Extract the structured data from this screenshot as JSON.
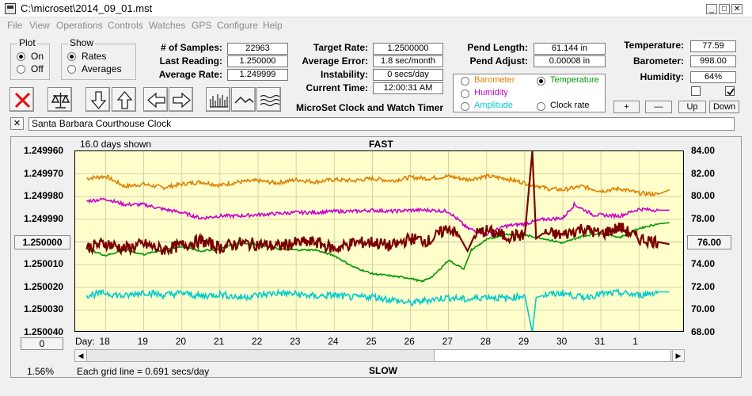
{
  "window": {
    "title": "C:\\microset\\2014_09_01.mst"
  },
  "menu": [
    "File",
    "View",
    "Operations",
    "Controls",
    "Watches",
    "GPS",
    "Configure",
    "Help"
  ],
  "plot_group": {
    "title": "Plot",
    "on_label": "On",
    "off_label": "Off",
    "selected": "On"
  },
  "show_group": {
    "title": "Show",
    "rates_label": "Rates",
    "averages_label": "Averages",
    "selected": "Rates"
  },
  "stats": {
    "samples_label": "# of Samples:",
    "samples": "22963",
    "last_reading_label": "Last Reading:",
    "last_reading": "1.250000",
    "average_rate_label": "Average Rate:",
    "average_rate": "1.249999",
    "target_rate_label": "Target Rate:",
    "target_rate": "1.2500000",
    "average_error_label": "Average Error:",
    "average_error": "1.8 sec/month",
    "instability_label": "Instability:",
    "instability": "0 secs/day",
    "current_time_label": "Current Time:",
    "current_time": "12:00:31 AM",
    "pend_length_label": "Pend Length:",
    "pend_length": "61.144 in",
    "pend_adjust_label": "Pend Adjust:",
    "pend_adjust": "0.00008 in",
    "temperature_label": "Temperature:",
    "temperature": "77.59",
    "barometer_label": "Barometer:",
    "barometer": "998.00",
    "humidity_label": "Humidity:",
    "humidity": "64%"
  },
  "app_caption": "MicroSet Clock and Watch Timer",
  "channel_select": {
    "options": [
      {
        "label": "Barometer",
        "color": "#e08000",
        "selected": false
      },
      {
        "label": "Temperature",
        "color": "#009900",
        "selected": true
      },
      {
        "label": "Humidity",
        "color": "#cc00cc",
        "selected": false
      },
      {
        "label": "Clock rate",
        "color": "#000000",
        "selected": false
      },
      {
        "label": "Amplitude",
        "color": "#00cccc",
        "selected": false
      }
    ]
  },
  "scale_buttons": {
    "plus": "+",
    "minus": "—",
    "up": "Up",
    "down": "Down"
  },
  "toolbar_icons": [
    "close-x-icon",
    "balance-scale-icon",
    "arrow-down-icon",
    "arrow-up-icon",
    "arrow-left-icon",
    "arrow-right-icon",
    "bars-icon",
    "wave-icon",
    "multi-wave-icon"
  ],
  "clock_name": {
    "close": "✕",
    "value": "Santa Barbara Courthouse Clock"
  },
  "chart": {
    "days_shown": "16.0 days shown",
    "top_label": "FAST",
    "bottom_label": "SLOW",
    "center_button": "1.250000",
    "right_button": "76.00",
    "zero_button": "0",
    "grid_note": "Each grid line = 0.691 secs/day",
    "zoom_percent": "1.56%",
    "day_prefix": "Day:"
  },
  "chart_data": {
    "type": "line",
    "x_label": "Day:",
    "x_ticks": [
      "18",
      "19",
      "20",
      "21",
      "22",
      "23",
      "24",
      "25",
      "26",
      "27",
      "28",
      "29",
      "30",
      "31",
      "1"
    ],
    "y_left_ticks": [
      "1.249960",
      "1.249970",
      "1.249980",
      "1.249990",
      "1.250000",
      "1.250010",
      "1.250020",
      "1.250030",
      "1.250040"
    ],
    "y_left_range": [
      1.24996,
      1.25004
    ],
    "y_right_ticks": [
      "84.00",
      "82.00",
      "80.00",
      "78.00",
      "76.00",
      "74.00",
      "72.00",
      "70.00",
      "68.00"
    ],
    "y_right_range": [
      68,
      84
    ],
    "grid": true,
    "series": [
      {
        "name": "Barometer",
        "color": "#e08000",
        "points": [
          [
            17.5,
            81.6
          ],
          [
            18,
            81.8
          ],
          [
            18.5,
            80.9
          ],
          [
            19,
            81.1
          ],
          [
            19.5,
            80.8
          ],
          [
            20,
            81.1
          ],
          [
            20.5,
            81.3
          ],
          [
            21,
            81.0
          ],
          [
            21.5,
            81.3
          ],
          [
            22,
            81.4
          ],
          [
            22.5,
            81.2
          ],
          [
            23,
            81.5
          ],
          [
            23.5,
            81.3
          ],
          [
            24,
            81.5
          ],
          [
            24.5,
            81.4
          ],
          [
            25,
            81.6
          ],
          [
            25.5,
            81.4
          ],
          [
            26,
            81.7
          ],
          [
            26.5,
            81.6
          ],
          [
            27,
            81.8
          ],
          [
            27.5,
            81.5
          ],
          [
            28,
            81.8
          ],
          [
            28.5,
            81.6
          ],
          [
            29,
            81.2
          ],
          [
            29.3,
            81.0
          ],
          [
            29.6,
            80.7
          ],
          [
            30,
            80.6
          ],
          [
            30.5,
            80.9
          ],
          [
            31,
            80.5
          ],
          [
            31.5,
            80.7
          ],
          [
            32,
            80.3
          ],
          [
            32.5,
            80.2
          ],
          [
            32.8,
            80.6
          ]
        ]
      },
      {
        "name": "Humidity",
        "color": "#cc00cc",
        "points": [
          [
            17.5,
            79.6
          ],
          [
            18,
            79.8
          ],
          [
            18.5,
            79.3
          ],
          [
            19,
            79.3
          ],
          [
            19.5,
            78.9
          ],
          [
            20,
            78.6
          ],
          [
            20.5,
            78.1
          ],
          [
            21,
            78.3
          ],
          [
            21.5,
            78.3
          ],
          [
            22,
            78.4
          ],
          [
            22.5,
            78.5
          ],
          [
            23,
            78.6
          ],
          [
            23.5,
            78.6
          ],
          [
            24,
            78.7
          ],
          [
            24.5,
            78.7
          ],
          [
            25,
            78.8
          ],
          [
            25.5,
            78.7
          ],
          [
            26,
            78.8
          ],
          [
            26.5,
            78.8
          ],
          [
            27,
            78.7
          ],
          [
            27.5,
            77.2
          ],
          [
            28,
            76.7
          ],
          [
            28.5,
            77.4
          ],
          [
            29,
            77.6
          ],
          [
            29.5,
            78.0
          ],
          [
            30,
            78.1
          ],
          [
            30.3,
            79.3
          ],
          [
            30.8,
            78.4
          ],
          [
            31.5,
            78.3
          ],
          [
            32,
            78.9
          ],
          [
            32.5,
            78.8
          ],
          [
            32.8,
            78.8
          ]
        ]
      },
      {
        "name": "Temperature",
        "color": "#009900",
        "points": [
          [
            17.5,
            75.4
          ],
          [
            18,
            74.8
          ],
          [
            18.5,
            75.3
          ],
          [
            19,
            74.9
          ],
          [
            19.5,
            75.3
          ],
          [
            20,
            75.6
          ],
          [
            20.5,
            75.2
          ],
          [
            21,
            75.4
          ],
          [
            21.5,
            75.9
          ],
          [
            22,
            75.8
          ],
          [
            22.5,
            75.4
          ],
          [
            23,
            75.3
          ],
          [
            23.5,
            75.3
          ],
          [
            24,
            74.8
          ],
          [
            24.5,
            73.8
          ],
          [
            25,
            73.2
          ],
          [
            25.5,
            73.0
          ],
          [
            26,
            72.8
          ],
          [
            26.3,
            72.5
          ],
          [
            26.6,
            73.0
          ],
          [
            27,
            74.4
          ],
          [
            27.4,
            73.6
          ],
          [
            27.6,
            75.3
          ],
          [
            28,
            76.2
          ],
          [
            28.5,
            76.7
          ],
          [
            29,
            76.6
          ],
          [
            29.5,
            76.3
          ],
          [
            30,
            75.9
          ],
          [
            30.5,
            76.5
          ],
          [
            31,
            76.8
          ],
          [
            31.5,
            76.4
          ],
          [
            32,
            77.2
          ],
          [
            32.5,
            77.6
          ],
          [
            32.8,
            77.7
          ]
        ]
      },
      {
        "name": "Clock rate",
        "color": "#7a0000",
        "points": [
          [
            17.5,
            75.5
          ],
          [
            18,
            75.9
          ],
          [
            18.5,
            75.4
          ],
          [
            19,
            75.8
          ],
          [
            19.5,
            75.3
          ],
          [
            20,
            75.7
          ],
          [
            20.5,
            76.1
          ],
          [
            21,
            75.5
          ],
          [
            21.5,
            75.9
          ],
          [
            22,
            75.8
          ],
          [
            22.5,
            75.6
          ],
          [
            23,
            75.9
          ],
          [
            23.5,
            76.0
          ],
          [
            24,
            75.4
          ],
          [
            24.5,
            75.9
          ],
          [
            25,
            76.0
          ],
          [
            25.5,
            75.6
          ],
          [
            26,
            76.3
          ],
          [
            26.5,
            76.1
          ],
          [
            27,
            77.3
          ],
          [
            27.3,
            76.4
          ],
          [
            27.5,
            75.2
          ],
          [
            27.7,
            76.7
          ],
          [
            28,
            77.0
          ],
          [
            28.5,
            76.5
          ],
          [
            29,
            76.6
          ],
          [
            29.2,
            84.0
          ],
          [
            29.3,
            76.3
          ],
          [
            29.5,
            76.8
          ],
          [
            30,
            76.6
          ],
          [
            30.5,
            77.2
          ],
          [
            31,
            76.7
          ],
          [
            31.5,
            77.3
          ],
          [
            32,
            76.3
          ],
          [
            32.5,
            76.0
          ],
          [
            32.8,
            75.8
          ]
        ]
      },
      {
        "name": "Amplitude",
        "color": "#00cccc",
        "points": [
          [
            17.5,
            71.3
          ],
          [
            18,
            71.5
          ],
          [
            18.5,
            71.2
          ],
          [
            19,
            71.6
          ],
          [
            19.5,
            71.3
          ],
          [
            20,
            71.5
          ],
          [
            20.5,
            71.2
          ],
          [
            21,
            71.4
          ],
          [
            21.5,
            71.1
          ],
          [
            22,
            71.3
          ],
          [
            22.5,
            71.5
          ],
          [
            23,
            71.4
          ],
          [
            23.5,
            71.2
          ],
          [
            24,
            71.3
          ],
          [
            24.5,
            71.1
          ],
          [
            25,
            71.2
          ],
          [
            25.5,
            70.9
          ],
          [
            26,
            70.6
          ],
          [
            26.5,
            70.9
          ],
          [
            27,
            71.1
          ],
          [
            27.5,
            70.9
          ],
          [
            28,
            71.2
          ],
          [
            28.5,
            71.0
          ],
          [
            29,
            71.3
          ],
          [
            29.2,
            68.0
          ],
          [
            29.3,
            71.1
          ],
          [
            29.5,
            71.3
          ],
          [
            30,
            71.5
          ],
          [
            30.5,
            71.1
          ],
          [
            31,
            71.4
          ],
          [
            31.5,
            71.5
          ],
          [
            32,
            71.3
          ],
          [
            32.5,
            71.6
          ],
          [
            32.8,
            71.6
          ]
        ]
      }
    ]
  }
}
